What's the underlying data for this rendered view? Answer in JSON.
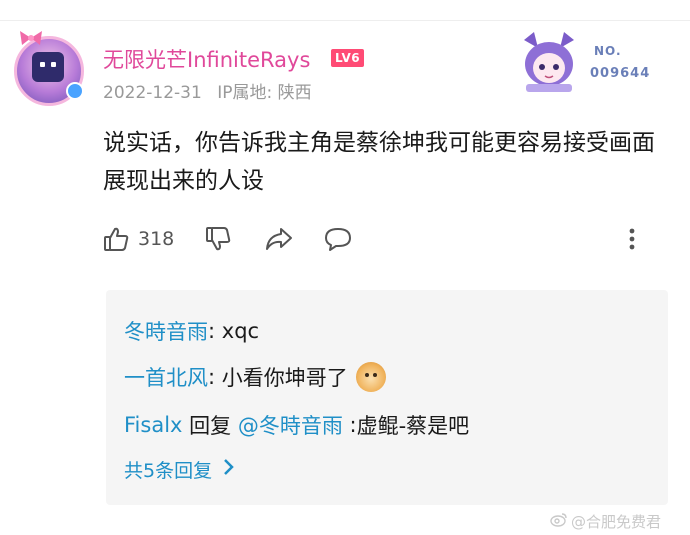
{
  "comment": {
    "username": "无限光芒InfiniteRays",
    "level_badge": "LV6",
    "date": "2022-12-31",
    "ip_location": "IP属地: 陕西",
    "text": "说实话，你告诉我主角是蔡徐坤我可能更容易接受画面展现出来的人设",
    "likes": "318",
    "fan_card": {
      "label": "NO.",
      "number": "009644"
    }
  },
  "replies": {
    "items": [
      {
        "user": "冬時音雨",
        "separator": ": ",
        "text": "xqc",
        "emoji": ""
      },
      {
        "user": "一首北风",
        "separator": ": ",
        "text": "小看你坤哥了",
        "emoji": "doge"
      },
      {
        "user": "Fisalx",
        "reply_word": " 回复 ",
        "mention": "@冬時音雨",
        "separator": " :",
        "text": "虚鲲-蔡是吧",
        "emoji": ""
      }
    ],
    "more_label": "共5条回复"
  },
  "watermark": "@合肥免费君",
  "colors": {
    "username": "#e0489a",
    "level": "#ff4b75",
    "link": "#1f8fc7",
    "reply_bg": "#f5f5f5"
  }
}
